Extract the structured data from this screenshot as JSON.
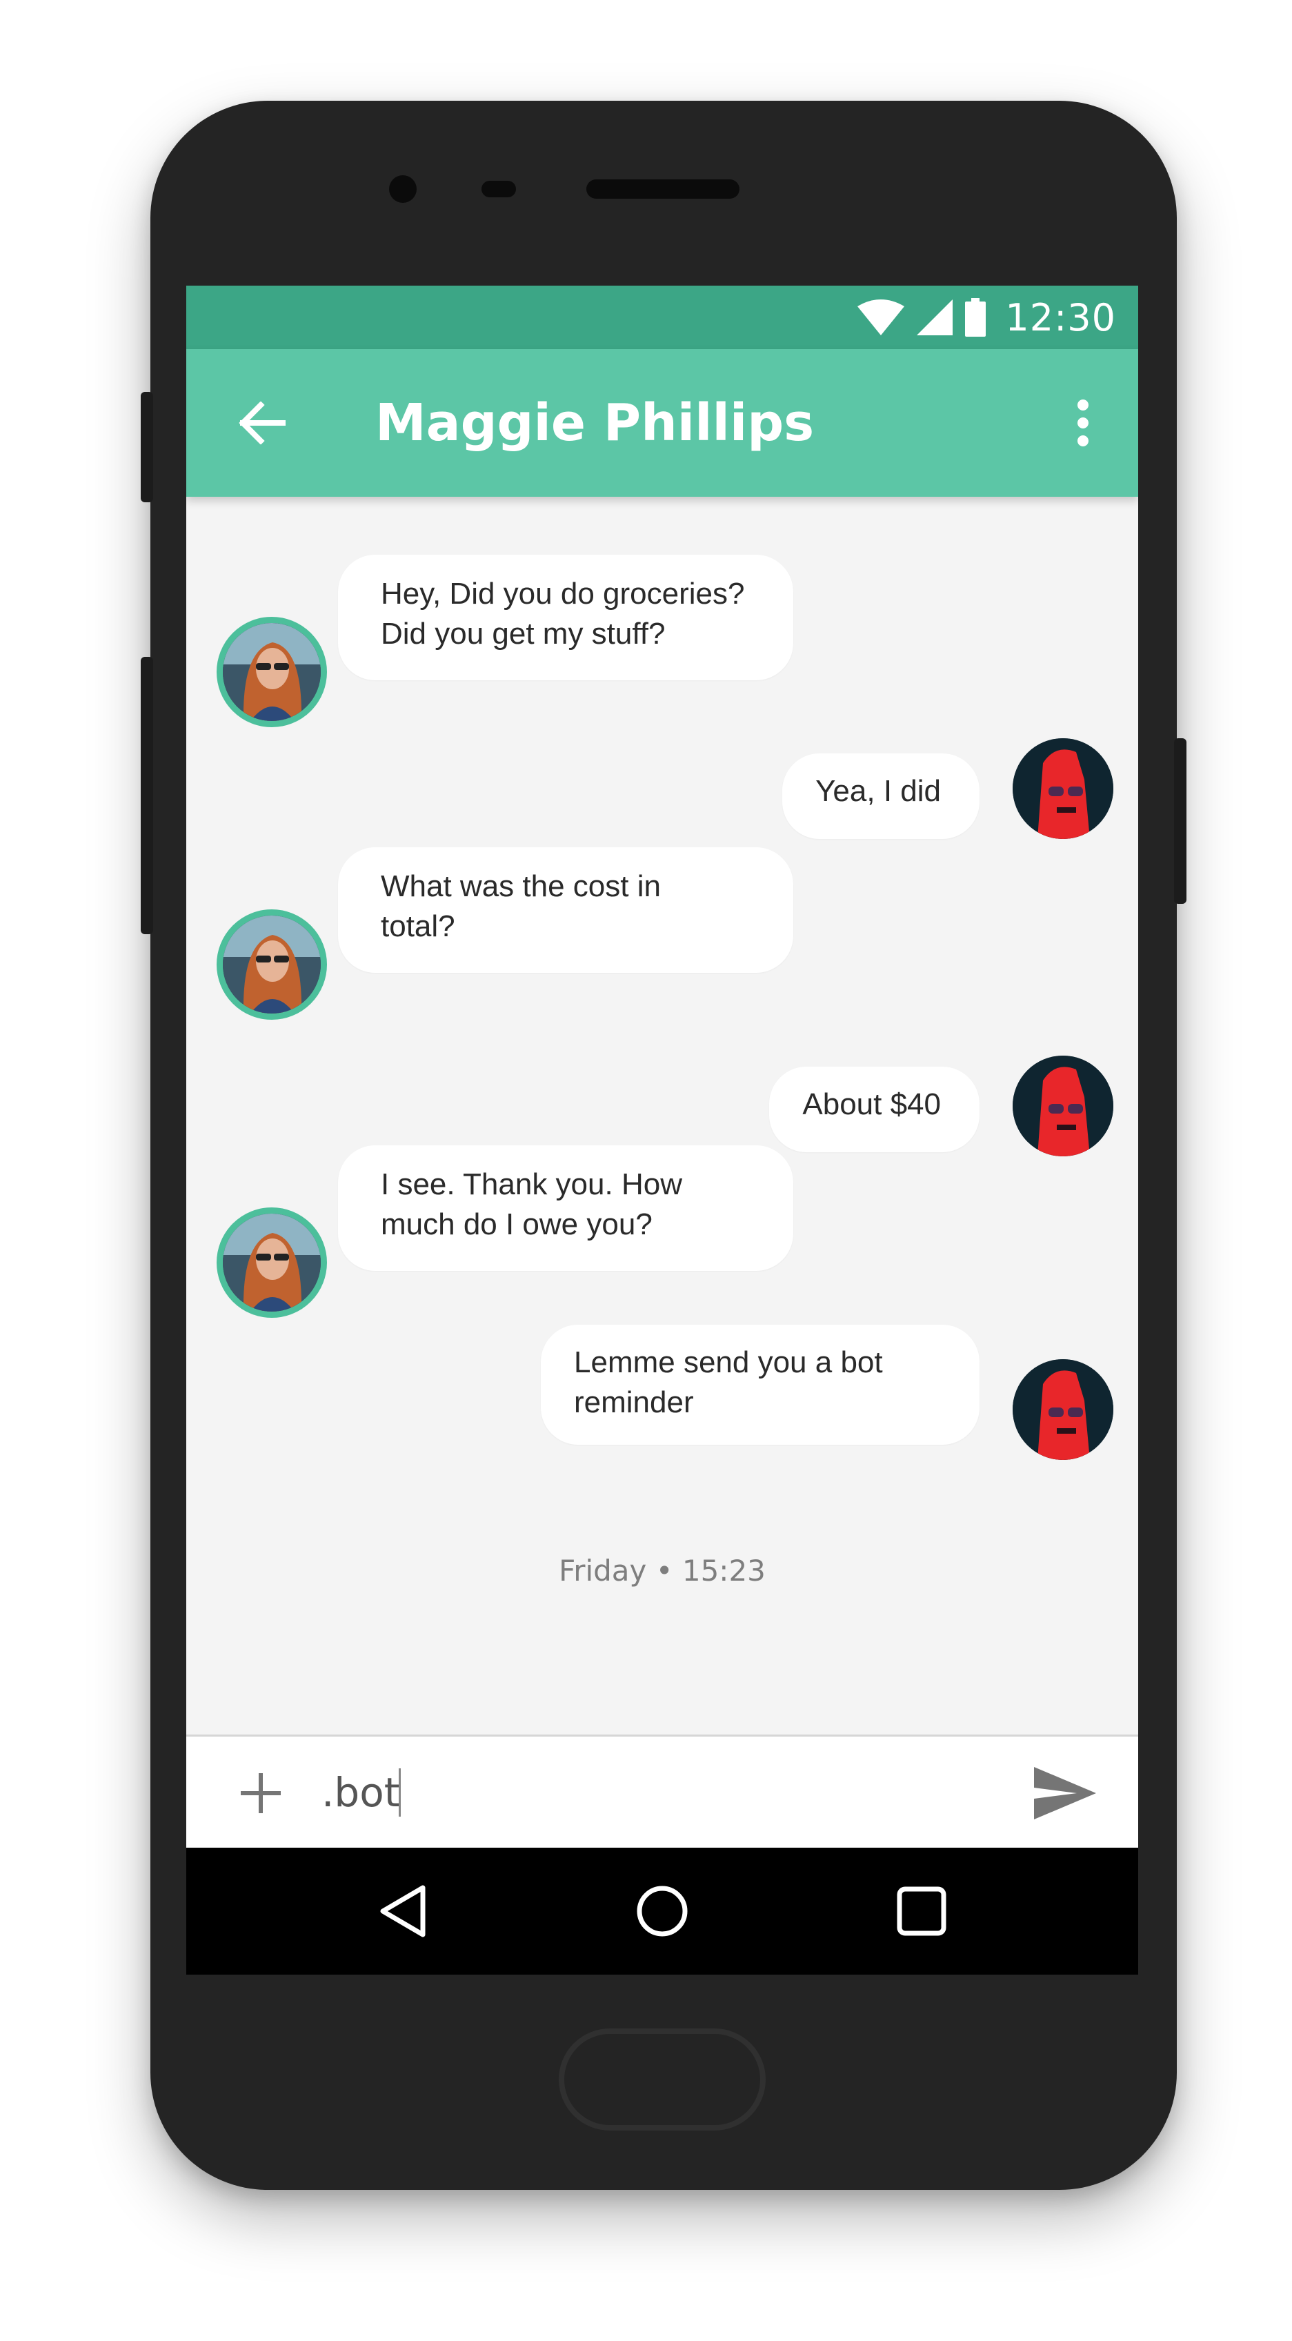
{
  "status_bar": {
    "time": "12:30",
    "icons": [
      "wifi-icon",
      "cellular-signal-icon",
      "battery-icon"
    ]
  },
  "app_bar": {
    "title": "Maggie Phillips",
    "back_icon": "arrow-left-icon",
    "menu_icon": "more-vertical-icon"
  },
  "messages": [
    {
      "from": "contact",
      "text": "Hey, Did you do groceries?\nDid you get my stuff?"
    },
    {
      "from": "me",
      "text": "Yea, I did"
    },
    {
      "from": "contact",
      "text": "What was the cost in\ntotal?"
    },
    {
      "from": "me",
      "text": "About $40"
    },
    {
      "from": "contact",
      "text": "I see. Thank you. How\nmuch do I owe you?"
    },
    {
      "from": "me",
      "text": "Lemme send you a bot\nreminder"
    }
  ],
  "timestamp": "Friday • 15:23",
  "composer": {
    "value": ".bot",
    "attach_icon": "plus-icon",
    "send_icon": "send-icon"
  },
  "colors": {
    "status_bar": "#3ca686",
    "app_bar": "#5cc6a6",
    "contact_avatar_ring": "#4cbf9b",
    "chat_background": "#f4f4f4"
  },
  "nav_bar": {
    "icons": [
      "back-triangle-icon",
      "home-circle-icon",
      "recent-square-icon"
    ]
  }
}
